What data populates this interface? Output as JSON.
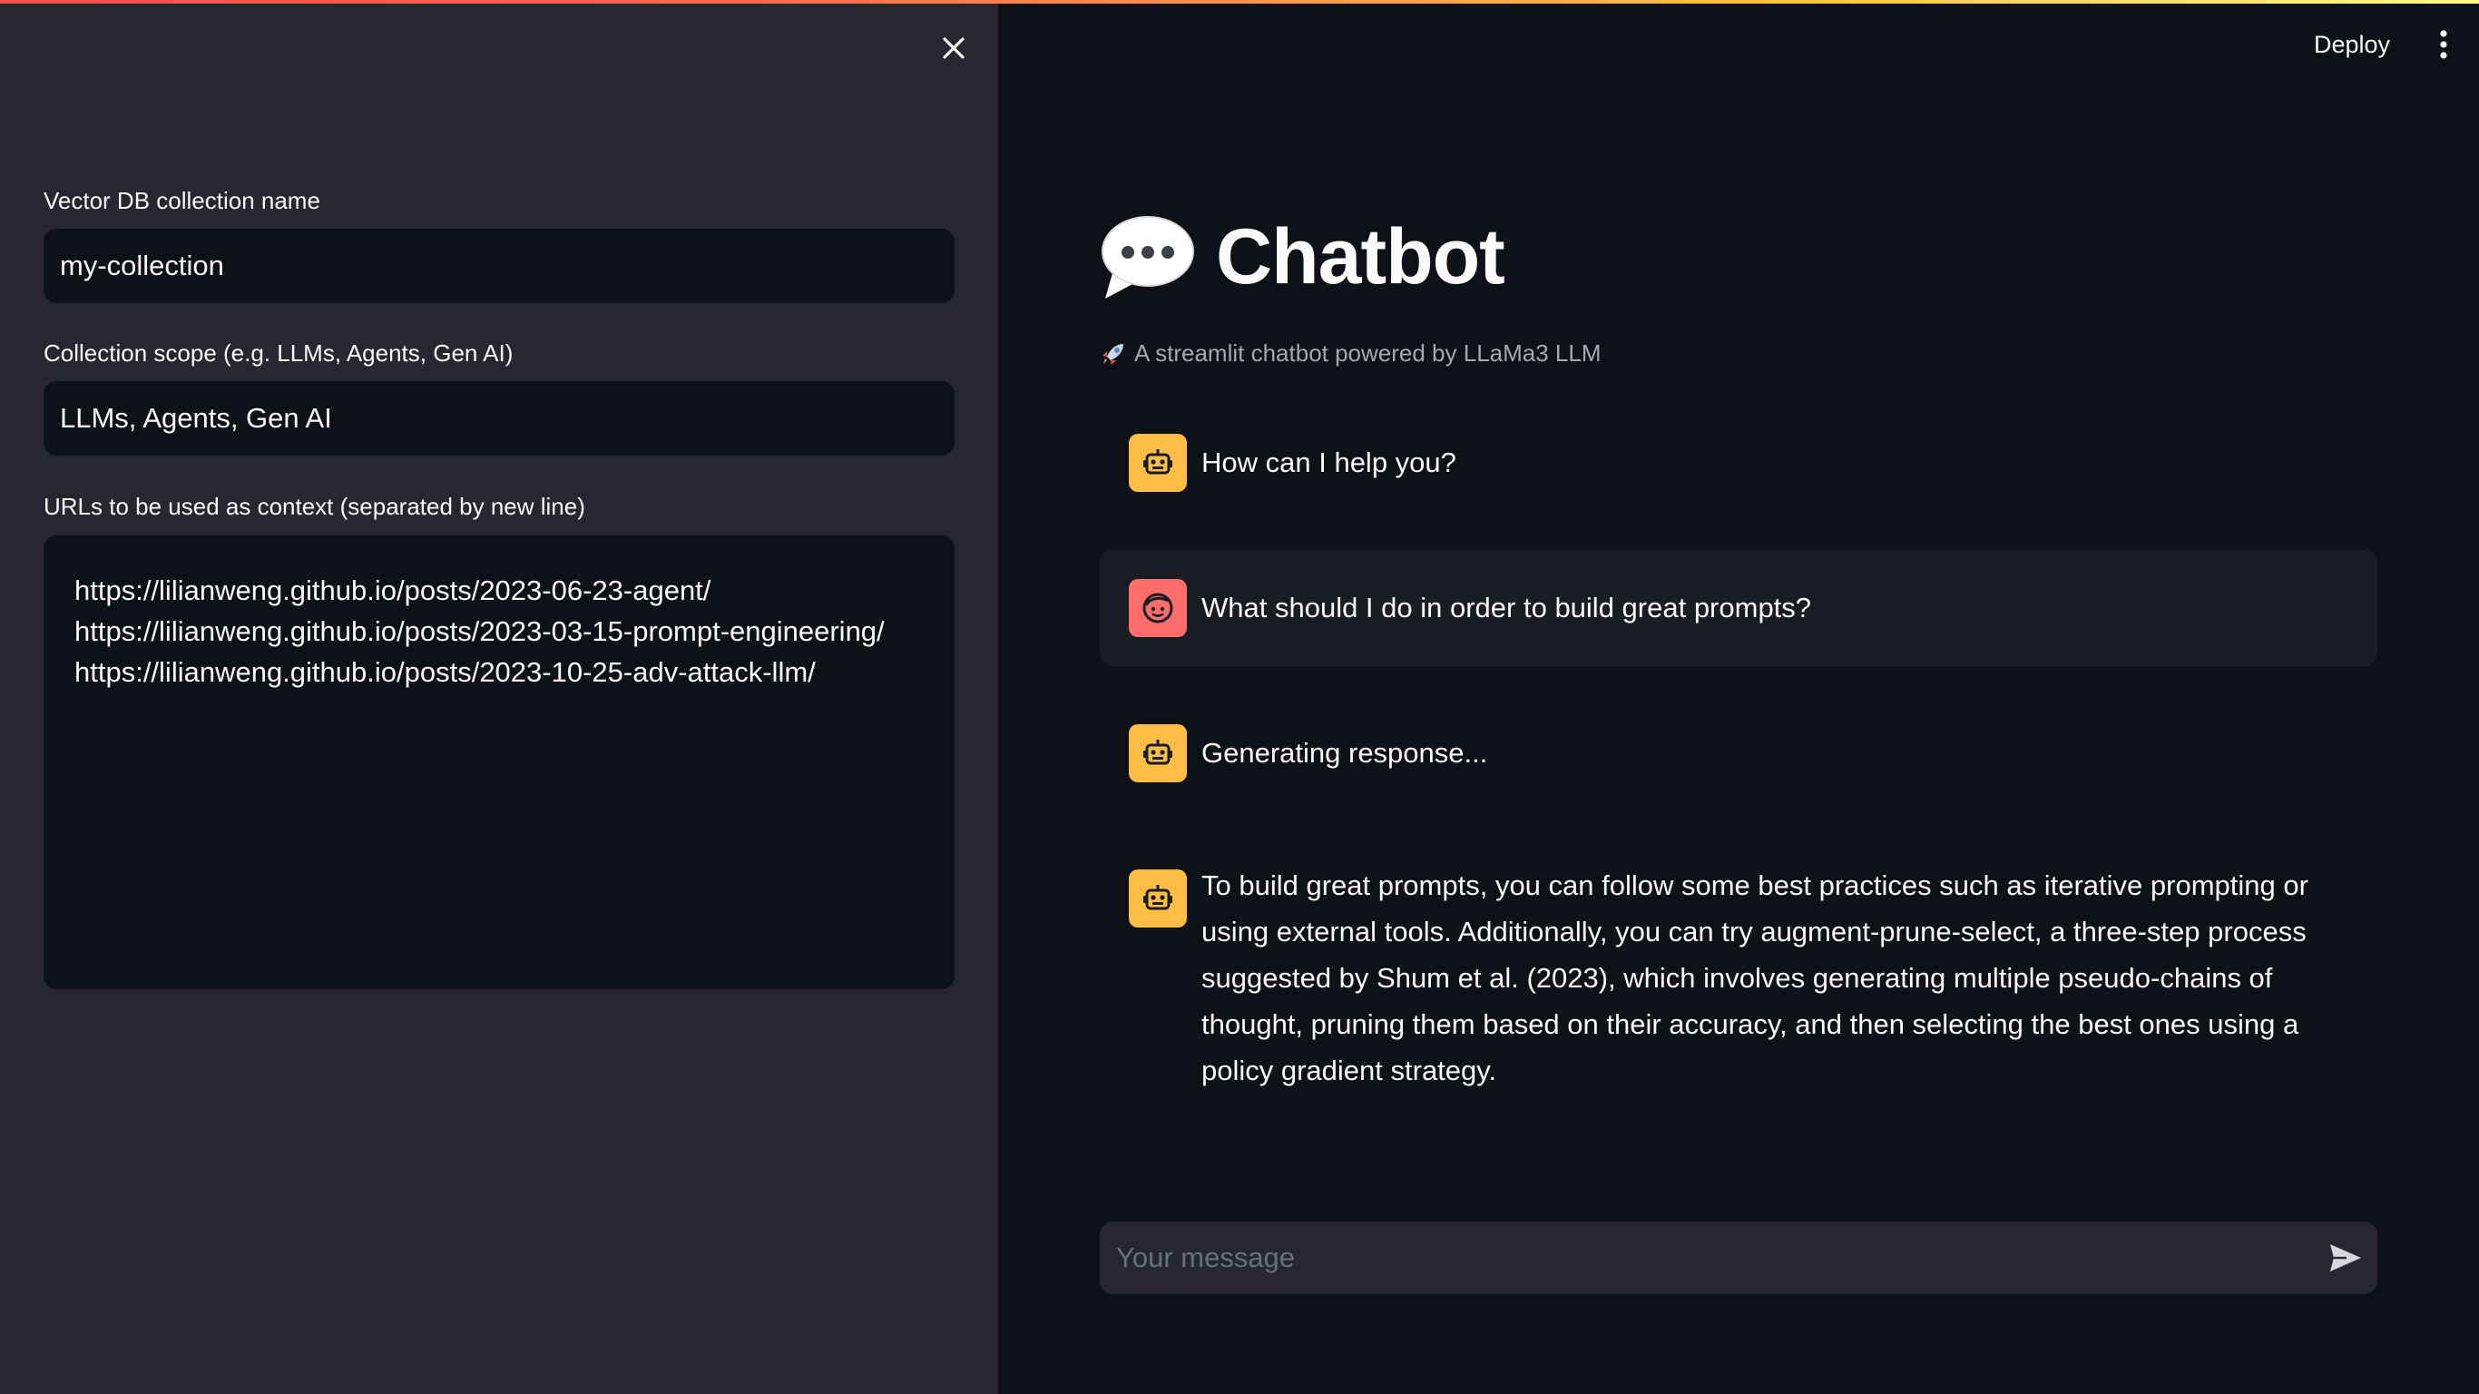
{
  "sidebar": {
    "collection_name": {
      "label": "Vector DB collection name",
      "value": "my-collection"
    },
    "collection_scope": {
      "label": "Collection scope (e.g. LLMs, Agents, Gen AI)",
      "value": "LLMs, Agents, Gen AI"
    },
    "urls": {
      "label": "URLs to be used as context (separated by new line)",
      "value": "https://lilianweng.github.io/posts/2023-06-23-agent/\nhttps://lilianweng.github.io/posts/2023-03-15-prompt-engineering/\nhttps://lilianweng.github.io/posts/2023-10-25-adv-attack-llm/"
    }
  },
  "header": {
    "deploy_label": "Deploy"
  },
  "main": {
    "title": "Chatbot",
    "title_icon": "speech-balloon-emoji",
    "caption": "A streamlit chatbot powered by LLaMa3 LLM",
    "caption_icon": "rocket-emoji",
    "messages": [
      {
        "role": "assistant",
        "text": "How can I help you?"
      },
      {
        "role": "user",
        "text": "What should I do in order to build great prompts?"
      },
      {
        "role": "assistant",
        "text": "Generating response..."
      },
      {
        "role": "assistant",
        "text": "To build great prompts, you can follow some best practices such as iterative prompting or using external tools. Additionally, you can try augment-prune-select, a three-step process suggested by Shum et al. (2023), which involves generating multiple pseudo-chains of thought, pruning them based on their accuracy, and then selecting the best ones using a policy gradient strategy."
      }
    ],
    "chat_input_placeholder": "Your message"
  },
  "colors": {
    "bot_avatar": "#ffbd45",
    "user_avatar": "#ff6c6c",
    "sidebar_bg": "#262730",
    "main_bg": "#0e1117"
  }
}
